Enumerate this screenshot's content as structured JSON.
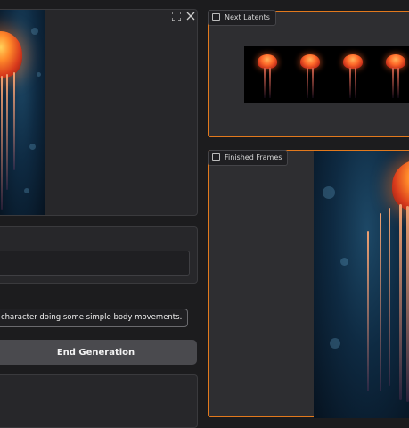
{
  "left": {
    "input_panel": {
      "expand_icon": "fullscreen-icon",
      "close_icon": "close-icon"
    },
    "prompt_field": {
      "value": ""
    },
    "prompt_example": "character doing some simple body movements.",
    "end_generation_label": "End Generation"
  },
  "right": {
    "next_latents": {
      "label": "Next Latents",
      "icon": "image-icon"
    },
    "finished_frames": {
      "label": "Finished Frames",
      "icon": "video-icon"
    }
  },
  "colors": {
    "accent_border": "#e2791d",
    "panel_bg": "#27272a",
    "page_bg": "#1c1c1e"
  }
}
